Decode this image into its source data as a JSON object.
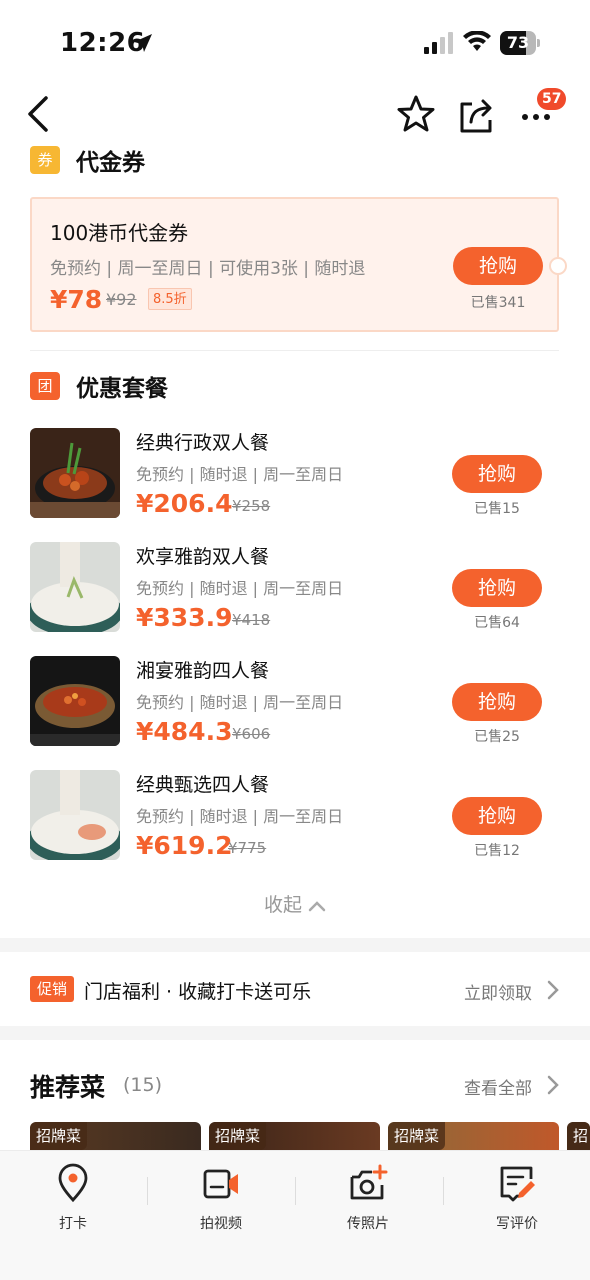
{
  "status_bar": {
    "time": "12:26",
    "battery": "73",
    "battery_level": 0.73
  },
  "nav": {
    "notification_count": "57"
  },
  "voucher_section": {
    "tag": "券",
    "title": "代金券",
    "card": {
      "title": "100港币代金券",
      "desc": "免预约 | 周一至周日 | 可使用3张 | 随时退",
      "price": "¥78",
      "original_price": "¥92",
      "discount": "8.5折",
      "button": "抢购",
      "sold": "已售341"
    }
  },
  "package_section": {
    "tag": "团",
    "title": "优惠套餐",
    "items": [
      {
        "name": "经典行政双人餐",
        "desc": "免预约 | 随时退 | 周一至周日",
        "price": "¥206.4",
        "original_price": "¥258",
        "button": "抢购",
        "sold": "已售15"
      },
      {
        "name": "欢享雅韵双人餐",
        "desc": "免预约 | 随时退 | 周一至周日",
        "price": "¥333.9",
        "original_price": "¥418",
        "button": "抢购",
        "sold": "已售64"
      },
      {
        "name": "湘宴雅韵四人餐",
        "desc": "免预约 | 随时退 | 周一至周日",
        "price": "¥484.3",
        "original_price": "¥606",
        "button": "抢购",
        "sold": "已售25"
      },
      {
        "name": "经典甄选四人餐",
        "desc": "免预约 | 随时退 | 周一至周日",
        "price": "¥619.2",
        "original_price": "¥775",
        "button": "抢购",
        "sold": "已售12"
      }
    ],
    "collapse_label": "收起"
  },
  "promo": {
    "tag": "促销",
    "text": "门店福利 · 收藏打卡送可乐",
    "link": "立即领取"
  },
  "recommend": {
    "title": "推荐菜",
    "count": "(15)",
    "link": "查看全部",
    "dishes": [
      {
        "tag": "招牌菜"
      },
      {
        "tag": "招牌菜"
      },
      {
        "tag": "招牌菜"
      },
      {
        "tag": "招"
      }
    ]
  },
  "bottom_bar": {
    "items": [
      {
        "label": "打卡",
        "icon": "location-pin-icon"
      },
      {
        "label": "拍视频",
        "icon": "video-camera-icon"
      },
      {
        "label": "传照片",
        "icon": "add-photo-icon"
      },
      {
        "label": "写评价",
        "icon": "write-review-icon"
      }
    ]
  },
  "colors": {
    "accent": "#f4622d",
    "badge": "#f04a2b",
    "voucher_bg": "#fff2ec",
    "voucher_tag": "#f7b733"
  }
}
